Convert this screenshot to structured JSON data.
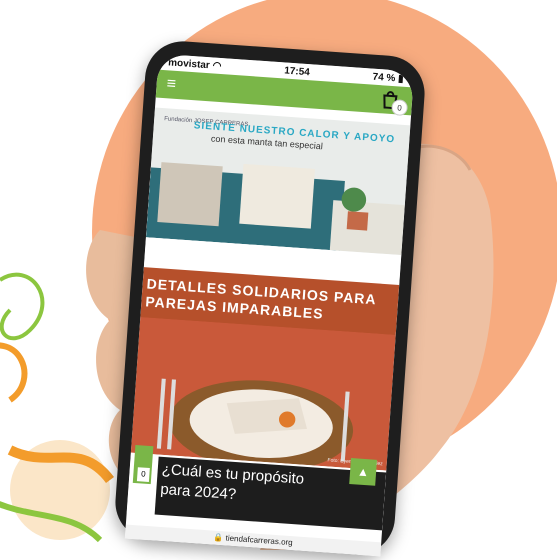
{
  "status_bar": {
    "carrier": "movistar",
    "time": "17:54",
    "battery": "74 %"
  },
  "nav": {
    "cart_count": "0"
  },
  "banner1": {
    "logo_text": "Fundación JOSEP CARRERAS",
    "title": "SIENTE NUESTRO CALOR Y APOYO",
    "subtitle": "con esta manta tan especial"
  },
  "banner2": {
    "title_line1": "DETALLES SOLIDARIOS PARA",
    "title_line2": "PAREJAS IMPARABLES",
    "credit": "Foto: Eyerman Gonzalez"
  },
  "purpose": {
    "count": "0",
    "line1": "¿Cuál es tu propósito",
    "line2": "para 2024?"
  },
  "address_bar": {
    "url": "tiendafcarreras.org"
  },
  "colors": {
    "accent_green": "#7ab648",
    "bg_peach": "#f7ab7f",
    "banner_orange": "#b6502b"
  }
}
